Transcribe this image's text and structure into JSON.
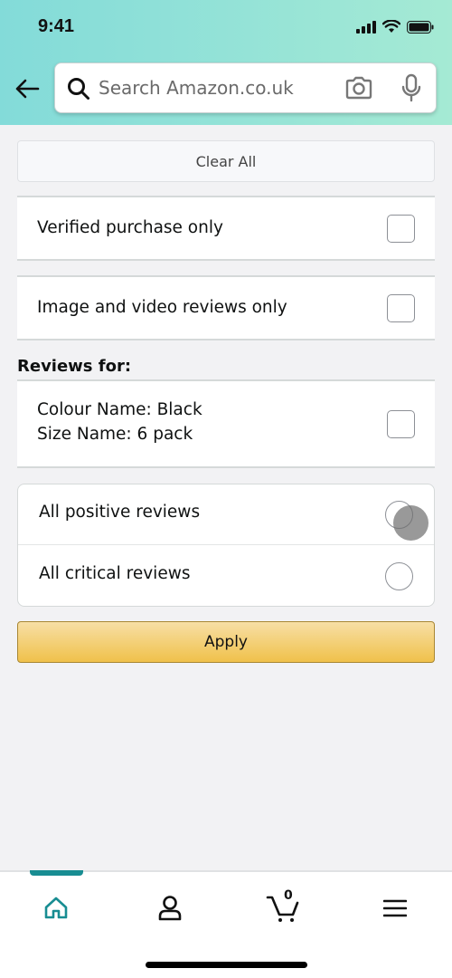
{
  "status_bar": {
    "time": "9:41"
  },
  "header": {
    "search_placeholder": "Search Amazon.co.uk"
  },
  "filters": {
    "clear_all_label": "Clear All",
    "verified_purchase_label": "Verified purchase only",
    "verified_purchase_checked": false,
    "image_video_label": "Image and video reviews only",
    "image_video_checked": false,
    "reviews_for_title": "Reviews for:",
    "variant_line1": "Colour Name: Black",
    "variant_line2": "Size Name: 6 pack",
    "variant_checked": false,
    "sentiment_options": [
      {
        "label": "All positive reviews",
        "selected": false
      },
      {
        "label": "All critical reviews",
        "selected": false
      }
    ],
    "apply_label": "Apply"
  },
  "bottom_nav": {
    "active": "home",
    "cart_count": "0",
    "accent_color": "#188d92"
  }
}
